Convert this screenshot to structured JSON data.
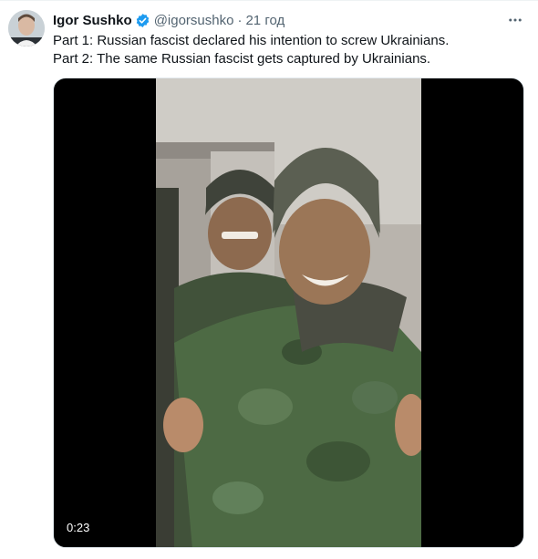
{
  "tweet": {
    "author_name": "Igor Sushko",
    "handle": "@igorsushko",
    "separator": "·",
    "time": "21 год",
    "lines": [
      "Part 1: Russian fascist declared his intention to screw Ukrainians.",
      "Part 2: The same Russian fascist gets captured by Ukrainians."
    ],
    "verified_icon": "verified-badge-icon",
    "more_icon": "more-horizontal-icon"
  },
  "media": {
    "duration": "0:23"
  },
  "colors": {
    "verified_blue": "#1d9bf0",
    "secondary_text": "#536471",
    "uniform_green": "#4d6a44"
  }
}
